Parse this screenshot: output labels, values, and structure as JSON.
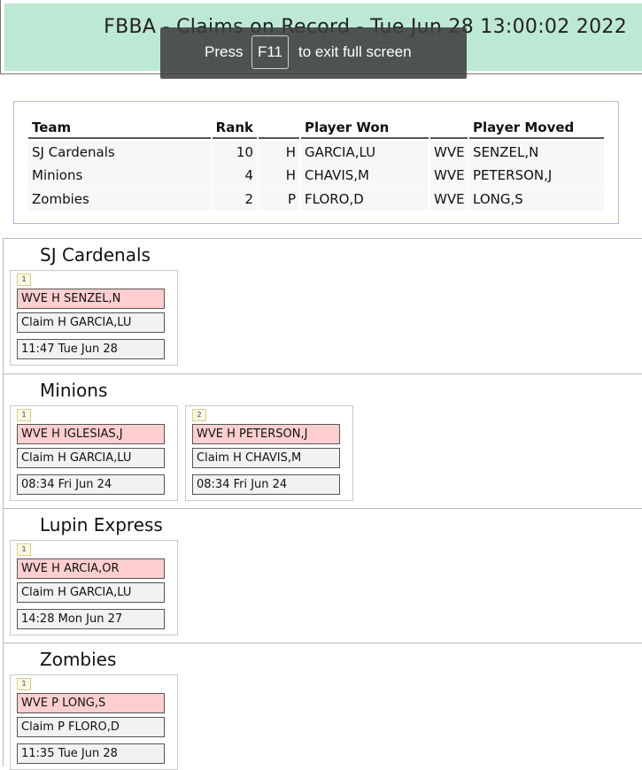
{
  "header": {
    "title": "FBBA - Claims on Record - Tue Jun 28 13:00:02 2022",
    "colors": {
      "bar": "#bde8d4"
    }
  },
  "fullscreen_notice": {
    "press": "Press",
    "key": "F11",
    "rest": "to exit full screen"
  },
  "summary": {
    "columns": [
      "Team",
      "Rank",
      "",
      "Player Won",
      "",
      "Player Moved"
    ],
    "rows": [
      {
        "team": "SJ Cardenals",
        "rank": "10",
        "pos": "H",
        "won": "GARCIA,LU",
        "type": "WVE",
        "moved": "SENZEL,N"
      },
      {
        "team": "Minions",
        "rank": "4",
        "pos": "H",
        "won": "CHAVIS,M",
        "type": "WVE",
        "moved": "PETERSON,J"
      },
      {
        "team": "Zombies",
        "rank": "2",
        "pos": "P",
        "won": "FLORO,D",
        "type": "WVE",
        "moved": "LONG,S"
      }
    ]
  },
  "teams": [
    {
      "name": "SJ Cardenals",
      "claims": [
        {
          "num": "1",
          "drop": "WVE H SENZEL,N",
          "claim": "Claim H GARCIA,LU",
          "time": "11:47 Tue Jun 28"
        }
      ]
    },
    {
      "name": "Minions",
      "claims": [
        {
          "num": "1",
          "drop": "WVE H IGLESIAS,J",
          "claim": "Claim H GARCIA,LU",
          "time": "08:34 Fri Jun 24"
        },
        {
          "num": "2",
          "drop": "WVE H PETERSON,J",
          "claim": "Claim H CHAVIS,M",
          "time": "08:34 Fri Jun 24"
        }
      ]
    },
    {
      "name": "Lupin Express",
      "claims": [
        {
          "num": "1",
          "drop": "WVE H ARCIA,OR",
          "claim": "Claim H GARCIA,LU",
          "time": "14:28 Mon Jun 27"
        }
      ]
    },
    {
      "name": "Zombies",
      "claims": [
        {
          "num": "1",
          "drop": "WVE P LONG,S",
          "claim": "Claim P FLORO,D",
          "time": "11:35 Tue Jun 28"
        }
      ]
    }
  ]
}
